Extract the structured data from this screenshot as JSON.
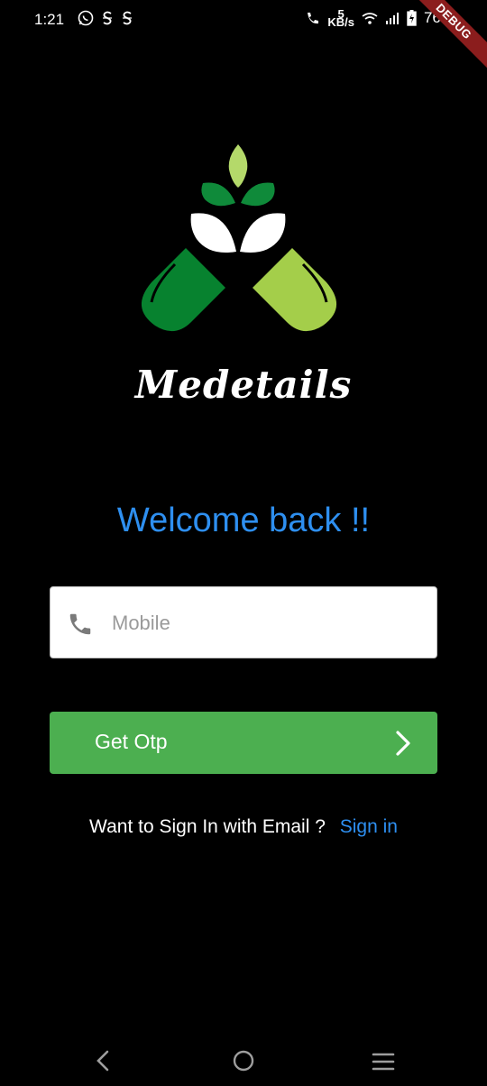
{
  "status_bar": {
    "time": "1:21",
    "notification_icons": [
      "whatsapp-icon",
      "s-app-icon",
      "s-app-icon"
    ],
    "network_speed_value": "5",
    "network_speed_unit": "KB/s",
    "battery_level": "76%",
    "debug_banner": "DEBUG"
  },
  "brand": {
    "name": "Medetails",
    "colors": {
      "dark_green": "#07822f",
      "light_green": "#a4ce4a",
      "leaf_dark": "#0f8a3a",
      "leaf_light": "#b4d96a"
    }
  },
  "login": {
    "welcome_text": "Welcome back !!",
    "mobile_placeholder": "Mobile",
    "mobile_value": "",
    "get_otp_label": "Get Otp",
    "email_prompt": "Want to Sign In with Email ?",
    "sign_in_link": "Sign in",
    "accent_color": "#2e8ff0",
    "button_color": "#4caf50"
  },
  "nav_bar": {
    "icons": [
      "back-icon",
      "home-icon",
      "recents-icon"
    ]
  }
}
